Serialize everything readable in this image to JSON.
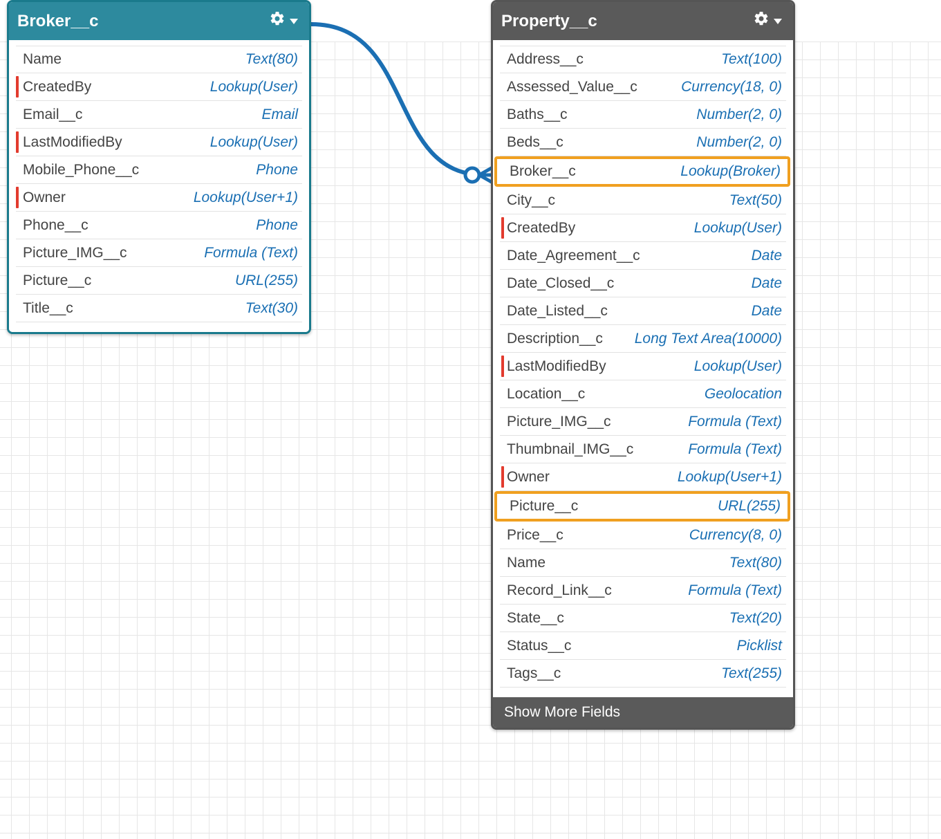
{
  "broker": {
    "title": "Broker__c",
    "fields": [
      {
        "name": "Name",
        "type": "Text(80)",
        "red": false,
        "hl": false
      },
      {
        "name": "CreatedBy",
        "type": "Lookup(User)",
        "red": true,
        "hl": false
      },
      {
        "name": "Email__c",
        "type": "Email",
        "red": false,
        "hl": false
      },
      {
        "name": "LastModifiedBy",
        "type": "Lookup(User)",
        "red": true,
        "hl": false
      },
      {
        "name": "Mobile_Phone__c",
        "type": "Phone",
        "red": false,
        "hl": false
      },
      {
        "name": "Owner",
        "type": "Lookup(User+1)",
        "red": true,
        "hl": false
      },
      {
        "name": "Phone__c",
        "type": "Phone",
        "red": false,
        "hl": false
      },
      {
        "name": "Picture_IMG__c",
        "type": "Formula (Text)",
        "red": false,
        "hl": false
      },
      {
        "name": "Picture__c",
        "type": "URL(255)",
        "red": false,
        "hl": false
      },
      {
        "name": "Title__c",
        "type": "Text(30)",
        "red": false,
        "hl": false
      }
    ]
  },
  "property": {
    "title": "Property__c",
    "show_more": "Show More Fields",
    "fields": [
      {
        "name": "Address__c",
        "type": "Text(100)",
        "red": false,
        "hl": false
      },
      {
        "name": "Assessed_Value__c",
        "type": "Currency(18, 0)",
        "red": false,
        "hl": false
      },
      {
        "name": "Baths__c",
        "type": "Number(2, 0)",
        "red": false,
        "hl": false
      },
      {
        "name": "Beds__c",
        "type": "Number(2, 0)",
        "red": false,
        "hl": false
      },
      {
        "name": "Broker__c",
        "type": "Lookup(Broker)",
        "red": false,
        "hl": true
      },
      {
        "name": "City__c",
        "type": "Text(50)",
        "red": false,
        "hl": false
      },
      {
        "name": "CreatedBy",
        "type": "Lookup(User)",
        "red": true,
        "hl": false
      },
      {
        "name": "Date_Agreement__c",
        "type": "Date",
        "red": false,
        "hl": false
      },
      {
        "name": "Date_Closed__c",
        "type": "Date",
        "red": false,
        "hl": false
      },
      {
        "name": "Date_Listed__c",
        "type": "Date",
        "red": false,
        "hl": false
      },
      {
        "name": "Description__c",
        "type": "Long Text Area(10000)",
        "red": false,
        "hl": false
      },
      {
        "name": "LastModifiedBy",
        "type": "Lookup(User)",
        "red": true,
        "hl": false
      },
      {
        "name": "Location__c",
        "type": "Geolocation",
        "red": false,
        "hl": false
      },
      {
        "name": "Picture_IMG__c",
        "type": "Formula (Text)",
        "red": false,
        "hl": false
      },
      {
        "name": "Thumbnail_IMG__c",
        "type": "Formula (Text)",
        "red": false,
        "hl": false
      },
      {
        "name": "Owner",
        "type": "Lookup(User+1)",
        "red": true,
        "hl": false
      },
      {
        "name": "Picture__c",
        "type": "URL(255)",
        "red": false,
        "hl": true
      },
      {
        "name": "Price__c",
        "type": "Currency(8, 0)",
        "red": false,
        "hl": false
      },
      {
        "name": "Name",
        "type": "Text(80)",
        "red": false,
        "hl": false
      },
      {
        "name": "Record_Link__c",
        "type": "Formula (Text)",
        "red": false,
        "hl": false
      },
      {
        "name": "State__c",
        "type": "Text(20)",
        "red": false,
        "hl": false
      },
      {
        "name": "Status__c",
        "type": "Picklist",
        "red": false,
        "hl": false
      },
      {
        "name": "Tags__c",
        "type": "Text(255)",
        "red": false,
        "hl": false
      }
    ]
  }
}
